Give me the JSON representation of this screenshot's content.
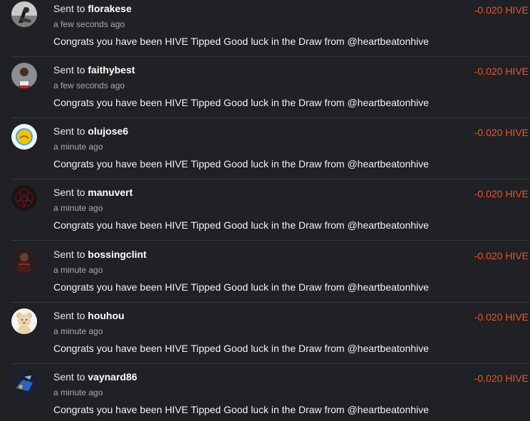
{
  "colors": {
    "background": "#1f2124",
    "amount": "#e8552d",
    "divider": "#33363b"
  },
  "transfers": [
    {
      "prefix": "Sent to",
      "user": "florakese",
      "time": "a few seconds ago",
      "memo": "Congrats you have been HIVE Tipped Good luck in the Draw from @heartbeatonhive",
      "amount": "-0.020 HIVE",
      "avatar": "rider-avatar-icon"
    },
    {
      "prefix": "Sent to",
      "user": "faithybest",
      "time": "a few seconds ago",
      "memo": "Congrats you have been HIVE Tipped Good luck in the Draw from @heartbeatonhive",
      "amount": "-0.020 HIVE",
      "avatar": "person-avatar-icon"
    },
    {
      "prefix": "Sent to",
      "user": "olujose6",
      "time": "a minute ago",
      "memo": "Congrats you have been HIVE Tipped Good luck in the Draw from @heartbeatonhive",
      "amount": "-0.020 HIVE",
      "avatar": "yellow-badge-avatar-icon"
    },
    {
      "prefix": "Sent to",
      "user": "manuvert",
      "time": "a minute ago",
      "memo": "Congrats you have been HIVE Tipped Good luck in the Draw from @heartbeatonhive",
      "amount": "-0.020 HIVE",
      "avatar": "pentagram-avatar-icon"
    },
    {
      "prefix": "Sent to",
      "user": "bossingclint",
      "time": "a minute ago",
      "memo": "Congrats you have been HIVE Tipped Good luck in the Draw from @heartbeatonhive",
      "amount": "-0.020 HIVE",
      "avatar": "warrior-avatar-icon"
    },
    {
      "prefix": "Sent to",
      "user": "houhou",
      "time": "a minute ago",
      "memo": "Congrats you have been HIVE Tipped Good luck in the Draw from @heartbeatonhive",
      "amount": "-0.020 HIVE",
      "avatar": "teddy-bear-avatar-icon"
    },
    {
      "prefix": "Sent to",
      "user": "vaynard86",
      "time": "a minute ago",
      "memo": "Congrats you have been HIVE Tipped Good luck in the Draw from @heartbeatonhive",
      "amount": "-0.020 HIVE",
      "avatar": "blue-robot-avatar-icon"
    }
  ]
}
